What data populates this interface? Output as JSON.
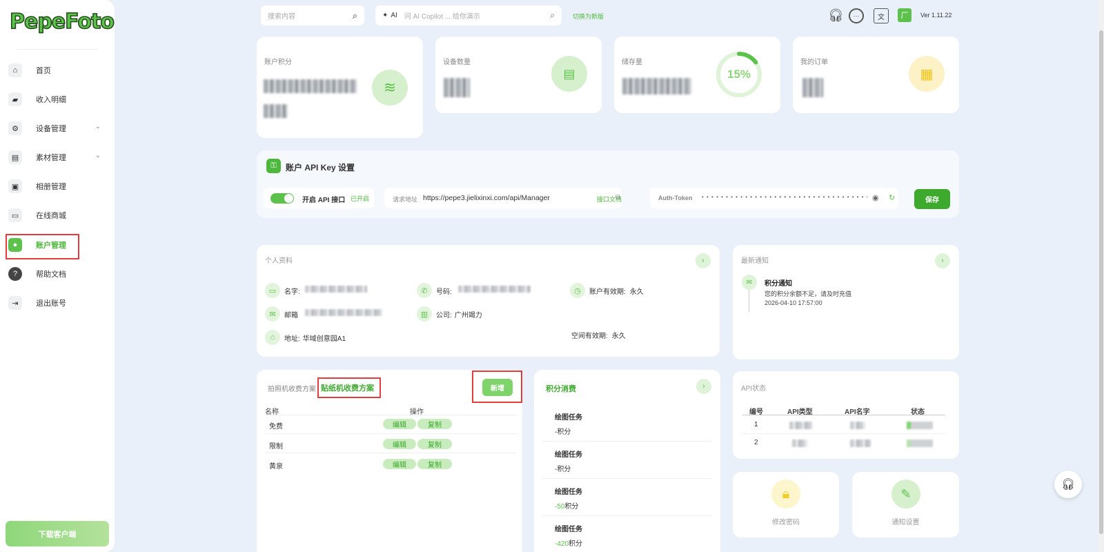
{
  "sidebar": {
    "logo": "PepeFoto",
    "items": [
      {
        "label": "首页",
        "icon": "home-icon"
      },
      {
        "label": "收入明细",
        "icon": "wallet-icon"
      },
      {
        "label": "设备管理",
        "icon": "gear-icon"
      },
      {
        "label": "素材管理",
        "icon": "material-icon"
      },
      {
        "label": "相册管理",
        "icon": "photo-icon"
      },
      {
        "label": "在线商城",
        "icon": "store-icon"
      },
      {
        "label": "账户管理",
        "icon": "user-icon"
      },
      {
        "label": "帮助文档",
        "icon": "help-icon"
      },
      {
        "label": "退出账号",
        "icon": "logout-icon"
      }
    ],
    "active_item": "账户管理",
    "download_label": "下载客户端"
  },
  "header": {
    "search_placeholder": "搜索内容",
    "ai_label": "AI",
    "ai_placeholder": "问 AI Copilot ... 给你演示",
    "switch_label": "切换为新版",
    "version": "Ver 1.11.22"
  },
  "stats": {
    "points_label": "账户积分",
    "devices_label": "设备数量",
    "storage_label": "储存量",
    "storage_percent": "15%",
    "storage_fraction": 0.15,
    "orders_label": "我的订单"
  },
  "api": {
    "title": "账户 API Key 设置",
    "toggle_label": "开启 API 接口",
    "toggle_status": "已开启",
    "url_label": "请求地址",
    "url": "https://pepe3.jielixinxi.com/api/Manager",
    "doc_label": "接口文档",
    "token_label": "Auth-Token",
    "token_mask": "• • • • • • • • • • • • • • • • • • • • • • • • • • • • • • • • • • • • • • •",
    "save_label": "保存"
  },
  "profile": {
    "title": "个人资料",
    "name_label": "名字:",
    "phone_label": "号码:",
    "validity_label": "账户有效期:",
    "validity_value": "永久",
    "email_label": "邮箱",
    "company_label": "公司:",
    "company_value": "广州竭力",
    "address_label": "地址:",
    "address_value": "华域创意园A1",
    "space_label": "空间有效期:",
    "space_value": "永久"
  },
  "notice": {
    "title": "最新通知",
    "item_title": "积分通知",
    "item_text": "您的积分余额不足，请及时充值",
    "item_time": "2026-04-10 17:57:00"
  },
  "pricing": {
    "tab_photo": "拍照机收费方案",
    "tab_sticker": "贴纸机收费方案",
    "add_label": "新增",
    "col_name": "名称",
    "col_action": "操作",
    "edit_label": "编辑",
    "copy_label": "复制",
    "rows": [
      "免费",
      "限制",
      "黄泉"
    ]
  },
  "consume": {
    "title": "积分消费",
    "items": [
      {
        "task": "绘图任务",
        "amount": "-",
        "unit": "积分"
      },
      {
        "task": "绘图任务",
        "amount": "-",
        "unit": "积分"
      },
      {
        "task": "绘图任务",
        "amount": "-50",
        "unit": "积分"
      },
      {
        "task": "绘图任务",
        "amount": "-420",
        "unit": "积分"
      }
    ]
  },
  "api_status": {
    "title": "API状态",
    "headers": [
      "编号",
      "API类型",
      "API名字",
      "状态"
    ],
    "rows": [
      "1",
      "2"
    ]
  },
  "shortcuts": {
    "password_label": "修改密码",
    "notify_label": "通知设置"
  },
  "colors": {
    "accent": "#5cc24c",
    "highlight": "#e23d3d",
    "background": "#eaf0f9"
  }
}
